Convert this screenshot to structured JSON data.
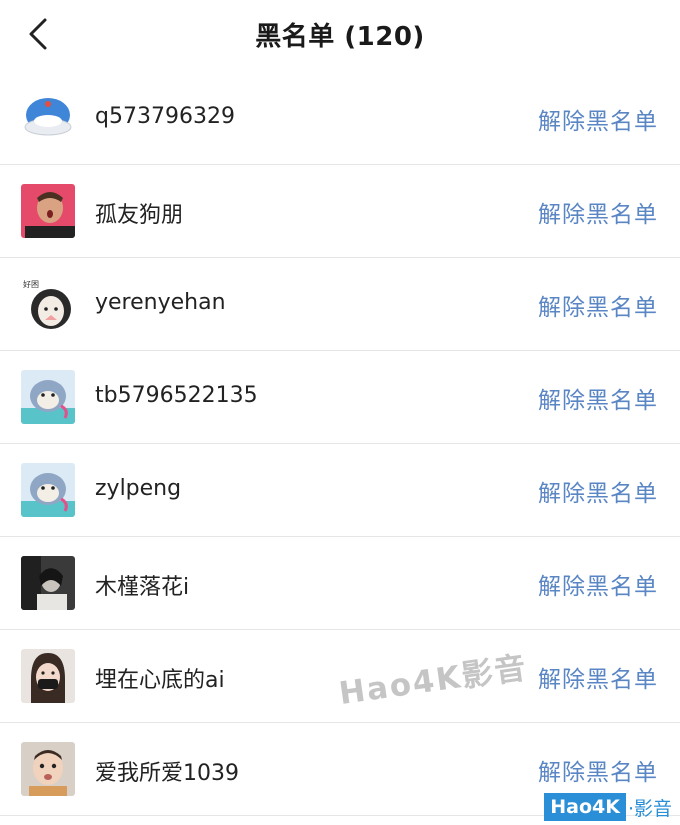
{
  "header": {
    "title": "黑名单 (120)"
  },
  "blocklist": [
    {
      "name": "q573796329",
      "action": "解除黑名单"
    },
    {
      "name": "孤友狗朋",
      "action": "解除黑名单"
    },
    {
      "name": "yerenyehan",
      "action": "解除黑名单"
    },
    {
      "name": "tb5796522135",
      "action": "解除黑名单"
    },
    {
      "name": "zylpeng",
      "action": "解除黑名单"
    },
    {
      "name": "木槿落花i",
      "action": "解除黑名单"
    },
    {
      "name": "埋在心底的ai",
      "action": "解除黑名单"
    },
    {
      "name": "爱我所爱1039",
      "action": "解除黑名单"
    }
  ],
  "watermark": {
    "text": "Hao4K影音"
  },
  "corner_badge": {
    "box_text": "Hao4K",
    "tail_text": "·影音"
  },
  "colors": {
    "accent": "#5a86c4",
    "divider": "#e6e6e6",
    "badge": "#2a8fd6"
  }
}
